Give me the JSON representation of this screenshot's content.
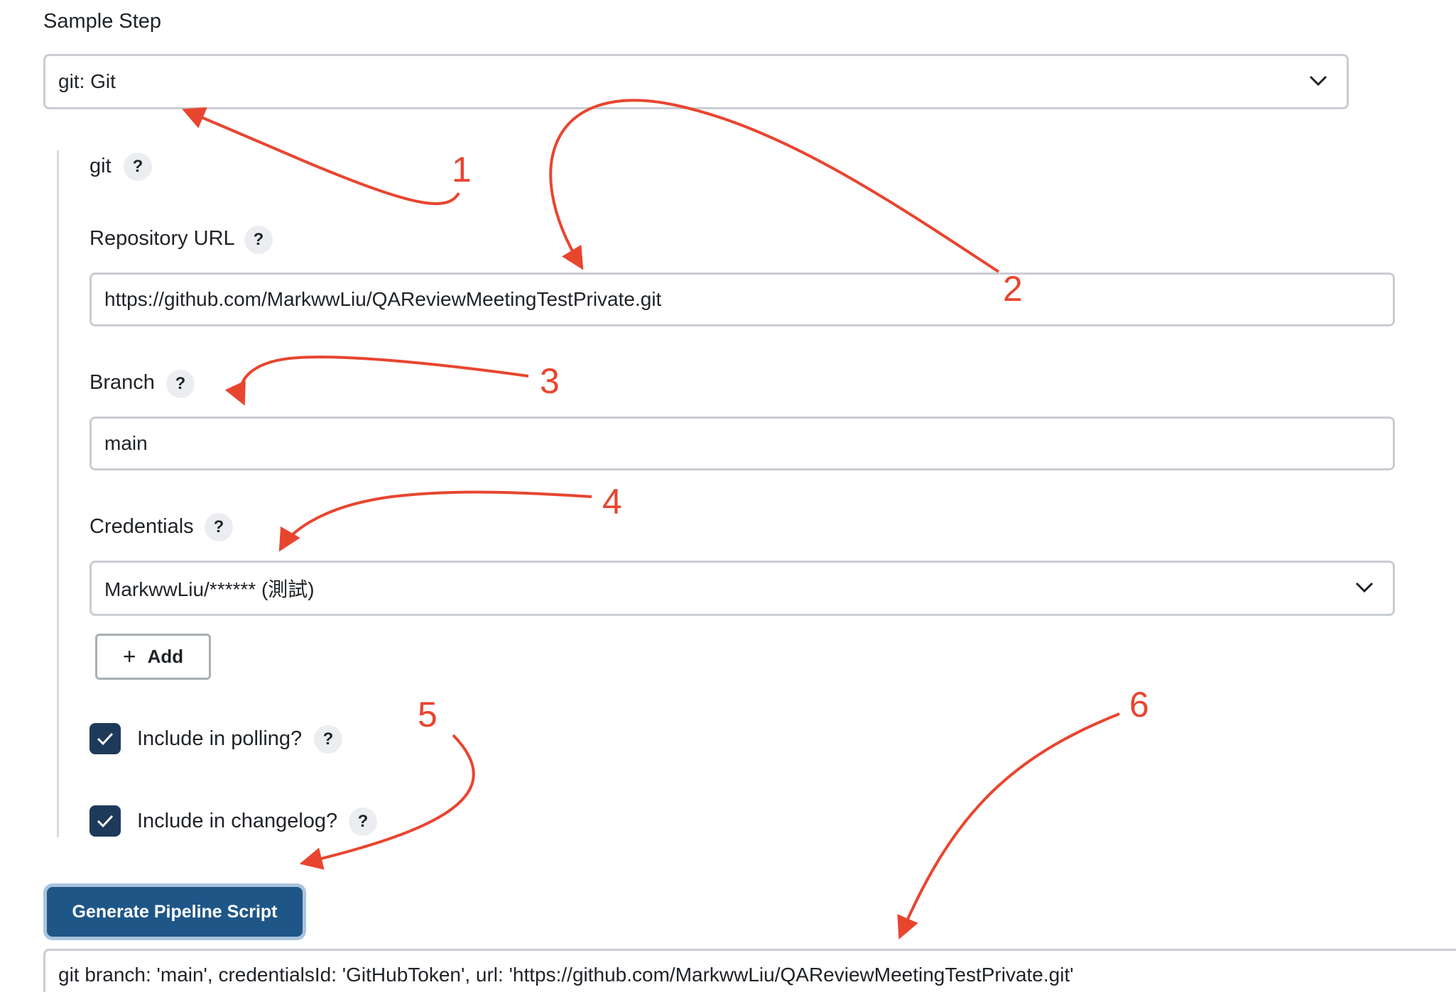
{
  "sample_step": {
    "label": "Sample Step",
    "selected": "git: Git"
  },
  "git_section": {
    "title": "git",
    "help": "?"
  },
  "repository_url": {
    "label": "Repository URL",
    "help": "?",
    "value": "https://github.com/MarkwwLiu/QAReviewMeetingTestPrivate.git"
  },
  "branch": {
    "label": "Branch",
    "help": "?",
    "value": "main"
  },
  "credentials": {
    "label": "Credentials",
    "help": "?",
    "selected": "MarkwwLiu/****** (測試)",
    "add_button": "Add",
    "add_icon": "+"
  },
  "include_polling": {
    "label": "Include in polling?",
    "help": "?",
    "checked": true
  },
  "include_changelog": {
    "label": "Include in changelog?",
    "help": "?",
    "checked": true
  },
  "generate_button": "Generate Pipeline Script",
  "output_script": "git branch: 'main', credentialsId: 'GitHubToken', url: 'https://github.com/MarkwwLiu/QAReviewMeetingTestPrivate.git'",
  "annotations": {
    "color": "#e8452f",
    "labels": [
      "1",
      "2",
      "3",
      "4",
      "5",
      "6"
    ]
  },
  "colors": {
    "primary_button": "#1f5688",
    "checkbox": "#1e3a5a",
    "border": "#c9cdd3"
  }
}
